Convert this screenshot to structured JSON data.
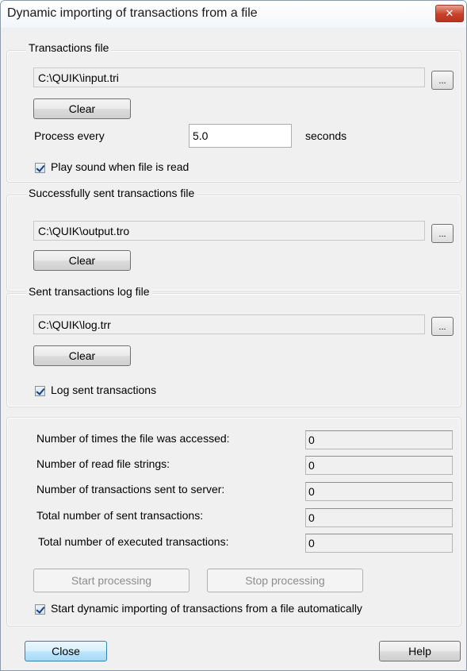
{
  "window": {
    "title": "Dynamic importing of transactions from a file",
    "close_glyph": "✕"
  },
  "transactions_file": {
    "legend": "Transactions file",
    "path": "C:\\QUIK\\input.tri",
    "browse_label": "...",
    "clear_label": "Clear",
    "process_label": "Process every",
    "process_value": "5.0",
    "process_unit": "seconds",
    "play_sound_label": "Play sound when file is read",
    "play_sound_checked": true
  },
  "sent_file": {
    "legend": "Successfully sent transactions file",
    "path": "C:\\QUIK\\output.tro",
    "browse_label": "...",
    "clear_label": "Clear"
  },
  "log_file": {
    "legend": "Sent transactions log file",
    "path": "C:\\QUIK\\log.trr",
    "browse_label": "...",
    "clear_label": "Clear",
    "log_label": "Log sent transactions",
    "log_checked": true
  },
  "stats": {
    "rows": [
      {
        "label": "Number of times the file was accessed:",
        "value": "0"
      },
      {
        "label": "Number of read file strings:",
        "value": "0"
      },
      {
        "label": "Number of transactions sent to server:",
        "value": "0"
      },
      {
        "label": "Total number of sent transactions:",
        "value": "0"
      },
      {
        "label": "Total number of executed transactions:",
        "value": "0"
      }
    ],
    "start_label": "Start processing",
    "stop_label": "Stop processing",
    "auto_start_label": "Start dynamic importing of transactions from a file automatically",
    "auto_start_checked": true
  },
  "footer": {
    "close_label": "Close",
    "help_label": "Help"
  }
}
